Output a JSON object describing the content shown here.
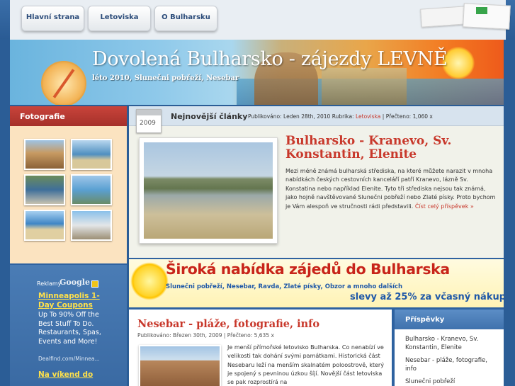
{
  "nav": {
    "tabs": [
      {
        "label": "Hlavní strana"
      },
      {
        "label": "Letoviska"
      },
      {
        "label": "O Bulharsku"
      }
    ]
  },
  "banner": {
    "title": "Dovolená Bulharsko - zájezdy LEVNĚ",
    "subtitle": "léto 2010, Slunečni pobřeží, Nesebar"
  },
  "sidebar": {
    "photos_heading": "Fotografie",
    "ads": {
      "label": "Reklamy",
      "brand": "Google",
      "ad1_title": "Minneapolis 1-Day Coupons",
      "ad1_body": "Up To 90% Off the Best Stuff To Do. Restaurants, Spas, Events and More!",
      "ad1_url": "Dealfind.com/Minnea...",
      "ad2_title": "Na víkend do"
    }
  },
  "featured": {
    "heading": "Nejnovější články",
    "calendar_year": "2009",
    "meta_published": "Publikováno: Leden 28th, 2010",
    "meta_category_label": "Rubrika:",
    "meta_category": "Letoviska",
    "meta_read": "| Přečteno: 1,060 x",
    "title": "Bulharsko - Kranevo, Sv. Konstantin, Elenite",
    "text": "Mezi méně známá bulharská střediska, na které můžete narazit v mnoha nabídkách českých cestovních kanceláří patří Kranevo, lázně Sv. Konstatina nebo například Elenite. Tyto tři střediska nejsou tak známá, jako hojně navštěvované Slunečni pobřeží nebo Zlaté písky. Proto bychom je Vám alespoň ve stručnosti rádi představili.",
    "more": "Číst celý příspěvek »"
  },
  "promo": {
    "headline": "Široká nabídka zájedů do Bulharska",
    "sub": "Slunečni pobřeží, Nesebar, Ravda, Zlaté písky, Obzor a mnoho dalších",
    "discount": "slevy až 25% za včasný nákup"
  },
  "post": {
    "title": "Nesebar - pláže, fotografie, info",
    "meta": "Publikováno: Březen 30th, 2009 | Přečteno: 5,635 x",
    "text": "Je menší přímořské letovisko Bulharska. Co nenabízí ve velikosti tak dohání svými památkami. Historická část Nesebaru leží na menším skalnatém poloostrově, který je spojený s pevninou úzkou šíjí. Novější část letoviska se pak rozprostírá na"
  },
  "posts_box": {
    "heading": "Příspěvky",
    "items": [
      "Bulharsko - Kranevo, Sv. Konstantin, Elenite",
      "Nesebar - pláže, fotografie, info",
      "Slunečni pobřeží"
    ]
  },
  "colors": {
    "accent_red": "#c8382b",
    "page_blue": "#2b5d96",
    "promo_blue": "#1f58a8"
  }
}
